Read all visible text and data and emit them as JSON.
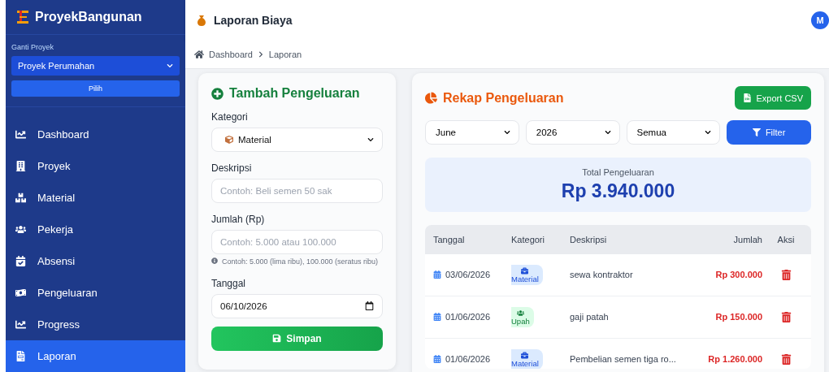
{
  "sidebar": {
    "brand": "ProyekBangunan",
    "project_switch": {
      "label": "Ganti Proyek",
      "value": "Proyek Perumahan",
      "button": "Pilih"
    },
    "items": [
      {
        "label": "Dashboard",
        "selected": false
      },
      {
        "label": "Proyek",
        "selected": false
      },
      {
        "label": "Material",
        "selected": false
      },
      {
        "label": "Pekerja",
        "selected": false
      },
      {
        "label": "Absensi",
        "selected": false
      },
      {
        "label": "Pengeluaran",
        "selected": false
      },
      {
        "label": "Progress",
        "selected": false
      },
      {
        "label": "Laporan",
        "selected": true
      }
    ]
  },
  "header": {
    "title": "Laporan Biaya",
    "avatar": "M"
  },
  "breadcrumb": [
    "Dashboard",
    "Laporan"
  ],
  "form": {
    "title": "Tambah Pengeluaran",
    "fields": [
      {
        "kind": "select",
        "label": "Kategori",
        "value": "Material"
      },
      {
        "kind": "text",
        "label": "Deskripsi",
        "placeholder": "Contoh: Beli semen 50 sak"
      },
      {
        "kind": "text",
        "label": "Jumlah (Rp)",
        "placeholder": "Contoh: 5.000 atau 100.000",
        "hint": "Contoh: 5.000 (lima ribu), 100.000 (seratus ribu)"
      },
      {
        "kind": "date",
        "label": "Tanggal",
        "value": "06/10/2026"
      }
    ],
    "button": "Simpan"
  },
  "summary": {
    "title": "Rekap Pengeluaran",
    "export": "Export CSV",
    "filters": [
      "June",
      "2026",
      "Semua"
    ],
    "filter_button": "Filter",
    "total_label": "Total Pengeluaran",
    "total": "Rp 3.940.000",
    "table": {
      "columns": [
        "Tanggal",
        "Kategori",
        "Deskripsi",
        "Jumlah",
        "Aksi"
      ],
      "rows": [
        {
          "date": "03/06/2026",
          "category": "Material",
          "color": "#dbeafe",
          "description": "sewa kontraktor",
          "amount": "Rp 300.000"
        },
        {
          "date": "01/06/2026",
          "category": "Upah",
          "color": "#dcfce7",
          "description": "gaji patah",
          "amount": "Rp 150.000"
        },
        {
          "date": "01/06/2026",
          "category": "Material",
          "color": "#dbeafe",
          "description": "Pembelian semen tiga ro...",
          "amount": "Rp 1.260.000"
        }
      ]
    }
  }
}
